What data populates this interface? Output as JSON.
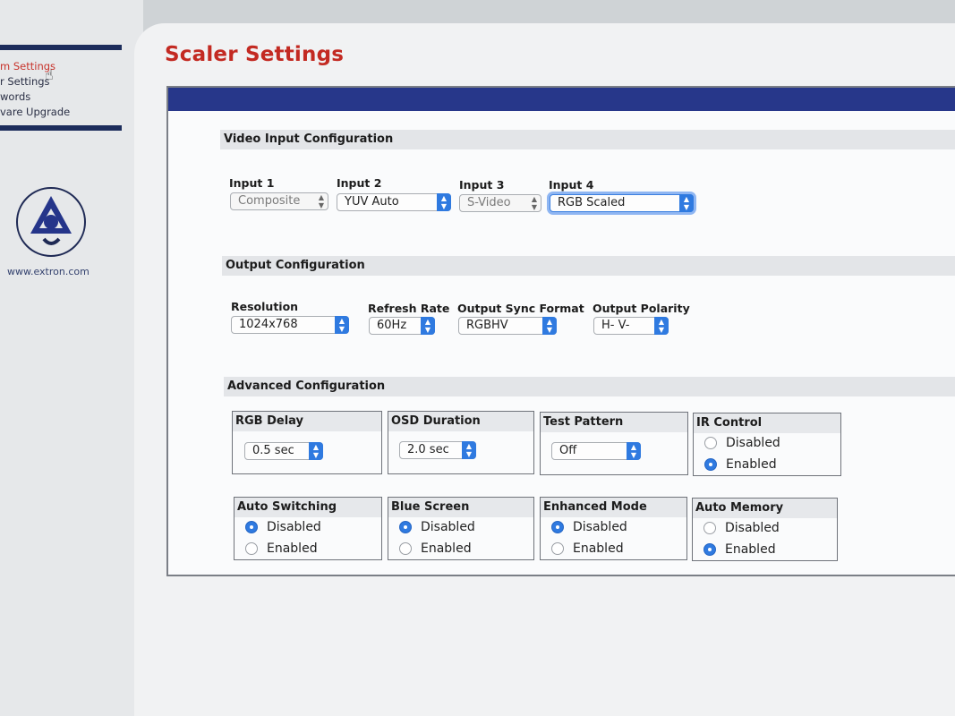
{
  "nav": {
    "items": [
      {
        "label": "m Settings",
        "active": true
      },
      {
        "label": "r Settings",
        "active": false
      },
      {
        "label": "words",
        "active": false
      },
      {
        "label": "vare Upgrade",
        "active": false
      }
    ],
    "logo_icon": "extron-service-support-solutions-logo",
    "website": "www.extron.com"
  },
  "page": {
    "title": "Scaler Settings"
  },
  "video_input": {
    "section_title": "Video Input Configuration",
    "inputs": [
      {
        "label": "Input 1",
        "value": "Composite"
      },
      {
        "label": "Input 2",
        "value": "YUV Auto"
      },
      {
        "label": "Input 3",
        "value": "S-Video"
      },
      {
        "label": "Input 4",
        "value": "RGB Scaled"
      }
    ]
  },
  "output": {
    "section_title": "Output Configuration",
    "resolution": {
      "label": "Resolution",
      "value": "1024x768"
    },
    "refresh_rate": {
      "label": "Refresh Rate",
      "value": "60Hz"
    },
    "sync_format": {
      "label": "Output Sync Format",
      "value": "RGBHV"
    },
    "polarity": {
      "label": "Output Polarity",
      "value": "H- V-"
    }
  },
  "advanced": {
    "section_title": "Advanced Configuration",
    "rgb_delay": {
      "label": "RGB Delay",
      "value": "0.5 sec"
    },
    "osd_duration": {
      "label": "OSD Duration",
      "value": "2.0 sec"
    },
    "test_pattern": {
      "label": "Test Pattern",
      "value": "Off"
    },
    "ir_control": {
      "label": "IR Control",
      "options": [
        "Disabled",
        "Enabled"
      ],
      "selected": "Enabled"
    },
    "auto_switching": {
      "label": "Auto Switching",
      "options": [
        "Disabled",
        "Enabled"
      ],
      "selected": "Disabled"
    },
    "blue_screen": {
      "label": "Blue Screen",
      "options": [
        "Disabled",
        "Enabled"
      ],
      "selected": "Disabled"
    },
    "enhanced_mode": {
      "label": "Enhanced Mode",
      "options": [
        "Disabled",
        "Enabled"
      ],
      "selected": "Disabled"
    },
    "auto_memory": {
      "label": "Auto Memory",
      "options": [
        "Disabled",
        "Enabled"
      ],
      "selected": "Enabled"
    }
  },
  "colors": {
    "title_red": "#c32a22",
    "header_blue": "#27378a",
    "select_accent": "#2f7ae0"
  }
}
